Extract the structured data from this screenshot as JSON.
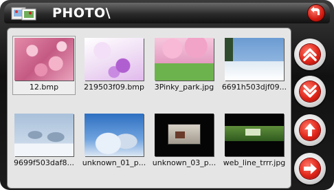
{
  "window": {
    "title": "PHOTO\\"
  },
  "icons": {
    "app": "photo-folder-icon",
    "back": "back-arrow-icon",
    "page_up": "double-chevron-up-icon",
    "page_down": "double-chevron-down-icon",
    "up_folder": "up-arrow-icon",
    "next": "right-arrow-icon"
  },
  "files": [
    {
      "label": "12.bmp",
      "selected": true
    },
    {
      "label": "219503f09.bmp",
      "selected": false
    },
    {
      "label": "3Pinky_park.jpg",
      "selected": false
    },
    {
      "label": "6691h503djf09...",
      "selected": false
    },
    {
      "label": "9699f503daf8...",
      "selected": false
    },
    {
      "label": "unknown_01_p...",
      "selected": false
    },
    {
      "label": "unknown_03_p...",
      "selected": false
    },
    {
      "label": "web_line_trrr.jpg",
      "selected": false
    }
  ],
  "colors": {
    "accent": "#e1261a",
    "panel": "#e5e5e5",
    "bezel": "#1c1c1c"
  }
}
